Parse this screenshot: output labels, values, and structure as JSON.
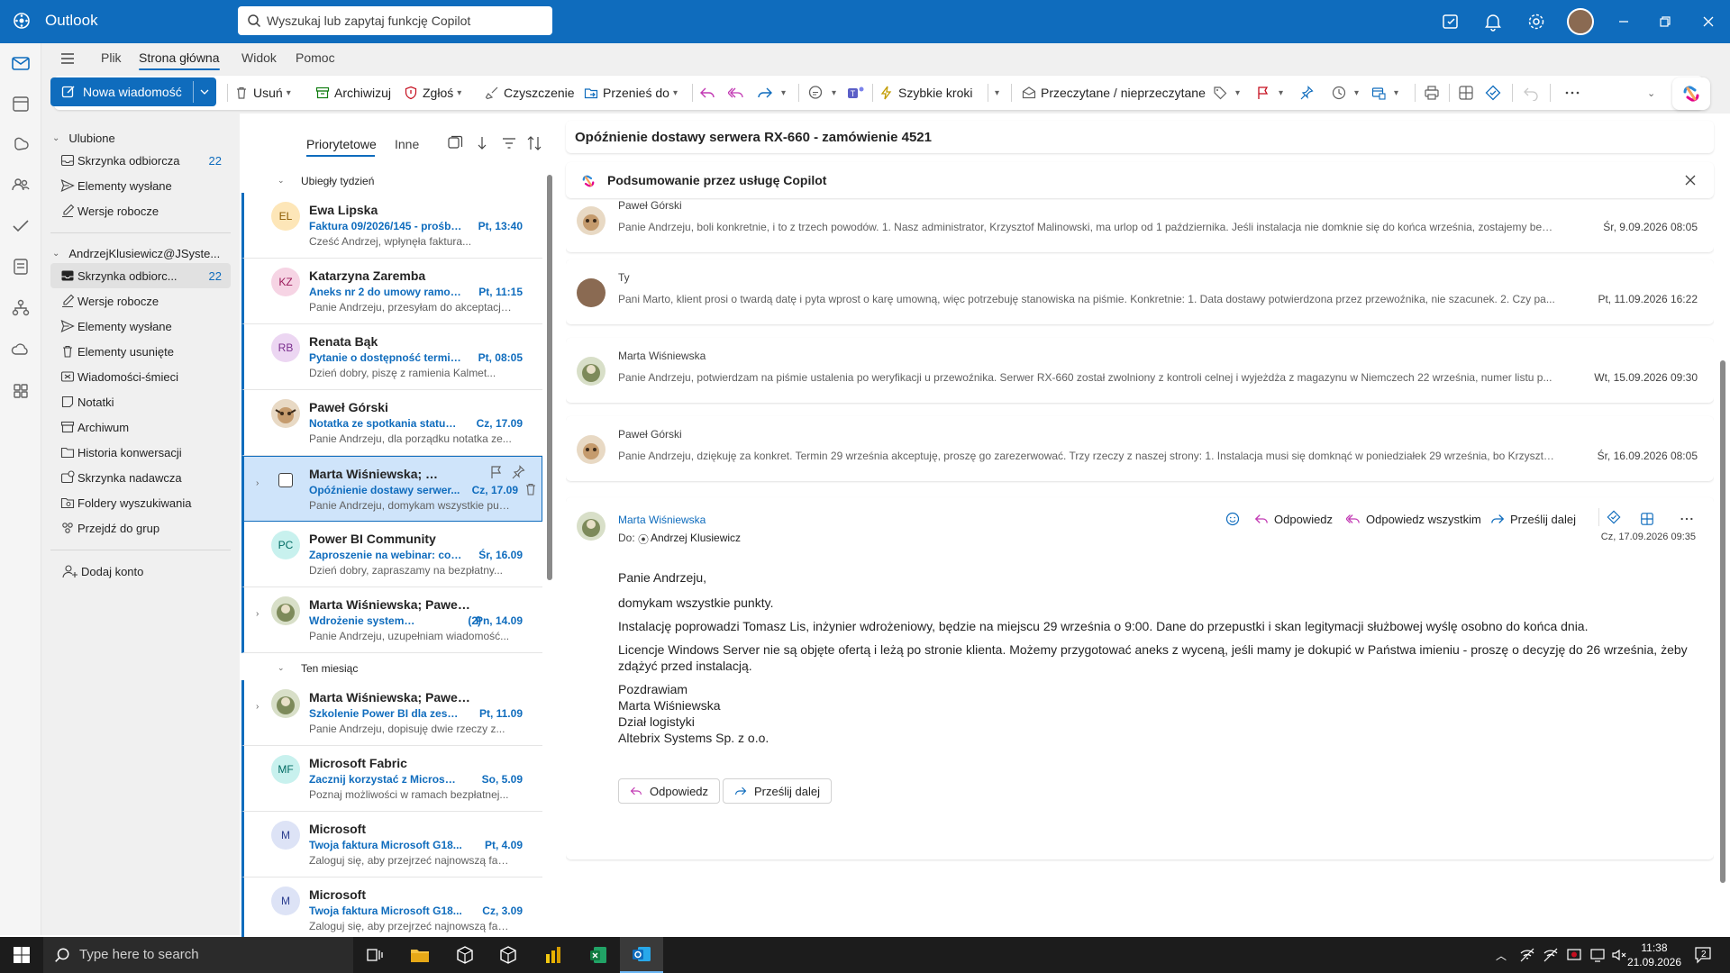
{
  "app": {
    "name": "Outlook",
    "accent": "#0f6cbd"
  },
  "search": {
    "placeholder": "Wyszukaj lub zapytaj funkcję Copilot"
  },
  "tabs": [
    {
      "label": "Plik"
    },
    {
      "label": "Strona główna",
      "active": true
    },
    {
      "label": "Widok"
    },
    {
      "label": "Pomoc"
    }
  ],
  "ribbon": {
    "new_message": "Nowa wiadomość",
    "delete": "Usuń",
    "archive": "Archiwizuj",
    "report": "Zgłoś",
    "sweep": "Czyszczenie",
    "move_to": "Przenieś do",
    "quick_steps": "Szybkie kroki",
    "read_unread": "Przeczytane / nieprzeczytane"
  },
  "folders": {
    "favorites_label": "Ulubione",
    "favorites": [
      {
        "label": "Skrzynka odbiorcza",
        "count": "22",
        "icon": "inbox-icon"
      },
      {
        "label": "Elementy wysłane",
        "count": "",
        "icon": "send-icon"
      },
      {
        "label": "Wersje robocze",
        "count": "",
        "icon": "draft-icon"
      }
    ],
    "account_label": "AndrzejKlusiewicz@JSyste...",
    "account": [
      {
        "label": "Skrzynka odbiorc...",
        "count": "22",
        "icon": "inbox-icon",
        "selected": true
      },
      {
        "label": "Wersje robocze",
        "count": "",
        "icon": "draft-icon"
      },
      {
        "label": "Elementy wysłane",
        "count": "",
        "icon": "send-icon"
      },
      {
        "label": "Elementy usunięte",
        "count": "",
        "icon": "trash-icon"
      },
      {
        "label": "Wiadomości-śmieci",
        "count": "",
        "icon": "junk-icon"
      },
      {
        "label": "Notatki",
        "count": "",
        "icon": "note-icon"
      },
      {
        "label": "Archiwum",
        "count": "",
        "icon": "archive-icon"
      },
      {
        "label": "Historia konwersacji",
        "count": "",
        "icon": "folder-icon"
      },
      {
        "label": "Skrzynka nadawcza",
        "count": "",
        "icon": "outbox-icon"
      },
      {
        "label": "Foldery wyszukiwania",
        "count": "",
        "icon": "search-folder-icon"
      },
      {
        "label": "Przejdź do grup",
        "count": "",
        "icon": "groups-icon"
      }
    ],
    "add_account": "Dodaj konto"
  },
  "list": {
    "tab_focused": "Priorytetowe",
    "tab_other": "Inne",
    "section_last_week": "Ubiegły tydzień",
    "section_this_month": "Ten miesiąc",
    "messages": [
      {
        "from": "Ewa Lipska",
        "initials": "EL",
        "avatar_bg": "#fde6b8",
        "subject": "Faktura 09/2026/145 - prośba o...",
        "date": "Pt, 13:40",
        "preview": "Cześć Andrzej, wpłynęła faktura..."
      },
      {
        "from": "Katarzyna Zaremba",
        "initials": "KZ",
        "avatar_bg": "#f6d4e4",
        "subject": "Aneks nr 2 do umowy ramowej",
        "date": "Pt, 11:15",
        "preview": "Panie Andrzeju, przesyłam do akceptacji..."
      },
      {
        "from": "Renata Bąk",
        "initials": "RB",
        "avatar_bg": "#ecd6f2",
        "subject": "Pytanie o dostępność terminu",
        "date": "Pt, 08:05",
        "preview": "Dzień dobry, piszę z ramienia Kalmet..."
      },
      {
        "from": "Paweł Górski",
        "initials": "",
        "avatar_bg": "#e8d9c4",
        "subject": "Notatka ze spotkania statusowego",
        "date": "Cz, 17.09",
        "preview": "Panie Andrzeju, dla porządku notatka ze..."
      },
      {
        "from": "Marta Wiśniewska; Paweł...",
        "initials": "",
        "avatar_bg": "#ffffff",
        "subject": "Opóźnienie dostawy serwer...",
        "date": "Cz, 17.09",
        "preview": "Panie Andrzeju, domykam wszystkie punkt...",
        "selected": true
      },
      {
        "from": "Power BI Community",
        "initials": "PC",
        "avatar_bg": "#c8f1ee",
        "subject": "Zaproszenie na webinar: co nowego",
        "date": "Śr, 16.09",
        "preview": "Dzień dobry, zapraszamy na bezpłatny..."
      },
      {
        "from": "Marta Wiśniewska; Paweł Górski",
        "initials": "",
        "avatar_bg": "#d8dfc8",
        "subject": "Wdrożenie systemu obsługi",
        "count": "(2)",
        "date": "Pn, 14.09",
        "preview": "Panie Andrzeju, uzupełniam wiadomość..."
      },
      {
        "from": "Marta Wiśniewska; Paweł Górski",
        "initials": "",
        "avatar_bg": "#d8dfc8",
        "subject": "Szkolenie Power BI dla zespołu",
        "date": "Pt, 11.09",
        "preview": "Panie Andrzeju, dopisuję dwie rzeczy z..."
      },
      {
        "from": "Microsoft Fabric",
        "initials": "MF",
        "avatar_bg": "#c8f1ee",
        "subject": "Zacznij korzystać z Microsoft Fabric",
        "date": "So, 5.09",
        "preview": "Poznaj możliwości w ramach bezpłatnej..."
      },
      {
        "from": "Microsoft",
        "initials": "M",
        "avatar_bg": "#dde3f6",
        "subject": "Twoja faktura Microsoft G18...",
        "date": "Pt, 4.09",
        "preview": "Zaloguj się, aby przejrzeć najnowszą faktur..."
      },
      {
        "from": "Microsoft",
        "initials": "M",
        "avatar_bg": "#dde3f6",
        "subject": "Twoja faktura Microsoft G18...",
        "date": "Cz, 3.09",
        "preview": "Zaloguj się, aby przejrzeć najnowszą faktur..."
      }
    ]
  },
  "reading": {
    "subject": "Opóźnienie dostawy serwera RX-660 - zamówienie 4521",
    "copilot_summary": "Podsumowanie przez usługę Copilot",
    "thread": [
      {
        "name": "Paweł Górski",
        "preview": "Panie Andrzeju, boli konkretnie, i to z trzech powodów. 1. Nasz administrator, Krzysztof Malinowski, ma urlop od 1 października. Jeśli instalacja nie domknie się do końca września, zostajemy bez ...",
        "date": "Śr, 9.09.2026 08:05"
      },
      {
        "name": "Ty",
        "preview": "Pani Marto, klient prosi o twardą datę i pyta wprost o karę umowną, więc potrzebuję stanowiska na piśmie. Konkretnie: 1. Data dostawy potwierdzona przez przewoźnika, nie szacunek. 2. Czy pa...",
        "date": "Pt, 11.09.2026 16:22"
      },
      {
        "name": "Marta Wiśniewska",
        "preview": "Panie Andrzeju, potwierdzam na piśmie ustalenia po weryfikacji u przewoźnika. Serwer RX-660 został zwolniony z kontroli celnej i wyjeżdża z magazynu w Niemczech 22 września, numer listu p...",
        "date": "Wt, 15.09.2026 09:30"
      },
      {
        "name": "Paweł Górski",
        "preview": "Panie Andrzeju, dziękuję za konkret. Termin 29 września akceptuję, proszę go zarezerwować. Trzy rzeczy z naszej strony: 1. Instalacja musi się domknąć w poniedziałek 29 września, bo Krzysztof ...",
        "date": "Śr, 16.09.2026 08:05"
      }
    ],
    "open": {
      "sender": "Marta Wiśniewska",
      "to_label": "Do:",
      "to": "Andrzej Klusiewicz",
      "date": "Cz, 17.09.2026 09:35",
      "actions": {
        "reply": "Odpowiedz",
        "reply_all": "Odpowiedz wszystkim",
        "forward": "Prześlij dalej"
      },
      "body": [
        "Panie Andrzeju,",
        "domykam wszystkie punkty.",
        "Instalację poprowadzi Tomasz Lis, inżynier wdrożeniowy, będzie na miejscu 29 września o 9:00. Dane do przepustki i skan legitymacji służbowej wyślę osobno do końca dnia.",
        "Licencje Windows Server nie są objęte ofertą i leżą po stronie klienta. Możemy przygotować aneks z wyceną, jeśli mamy je dokupić w Państwa imieniu - proszę o decyzję do 26 września, żeby zdążyć przed instalacją.",
        "Pozdrawiam",
        "Marta Wiśniewska",
        "Dział logistyki",
        "Altebrix Systems Sp. z o.o."
      ],
      "btn_reply": "Odpowiedz",
      "btn_forward": "Prześlij dalej"
    }
  },
  "taskbar": {
    "search_placeholder": "Type here to search",
    "time": "11:38",
    "date": "21.09.2026",
    "notifications": "2"
  }
}
